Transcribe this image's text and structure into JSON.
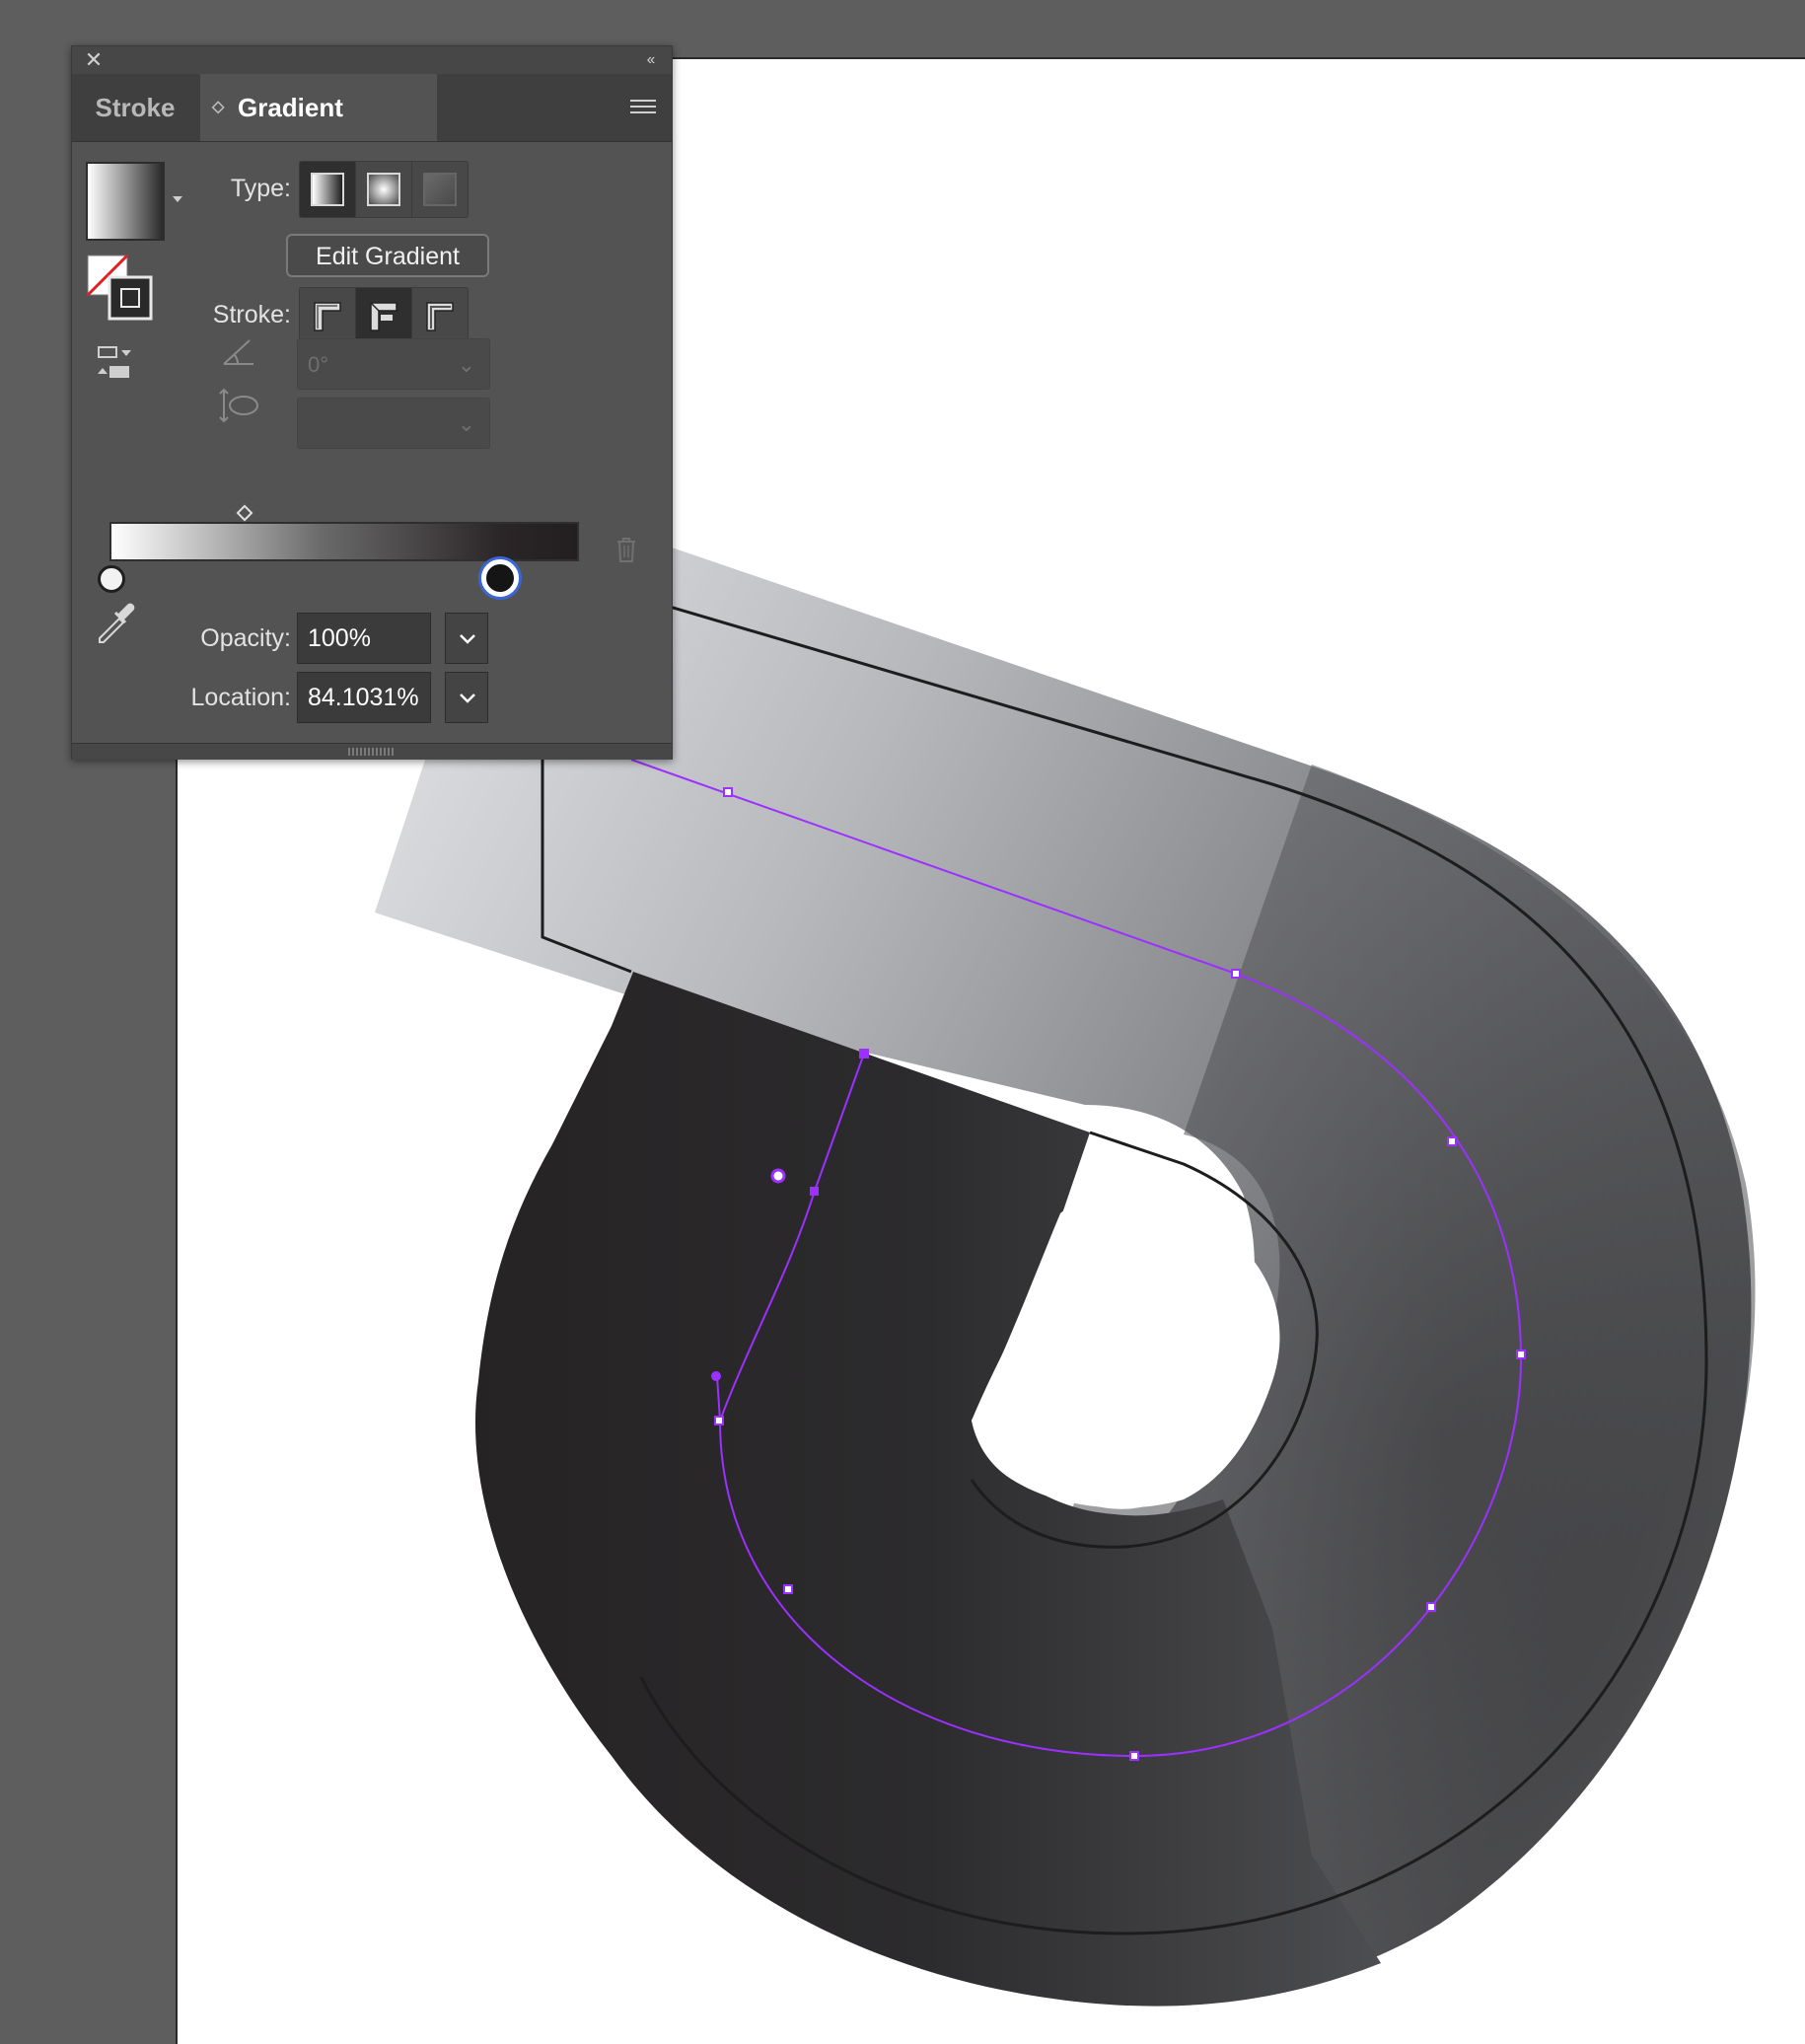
{
  "panel": {
    "tabs": [
      {
        "label": "Stroke",
        "active": false
      },
      {
        "label": "Gradient",
        "active": true
      }
    ],
    "type_label": "Type:",
    "type_options": [
      "linear-gradient-icon",
      "radial-gradient-icon",
      "freeform-gradient-icon"
    ],
    "type_selected": "linear",
    "edit_gradient_label": "Edit Gradient",
    "stroke_label": "Stroke:",
    "stroke_options": [
      "apply-within-stroke-icon",
      "apply-along-stroke-icon",
      "apply-across-stroke-icon"
    ],
    "stroke_selected": "along",
    "angle_value": "0°",
    "aspect_value": "",
    "opacity_label": "Opacity:",
    "opacity_value": "100%",
    "location_label": "Location:",
    "location_value": "84.1031%"
  },
  "gradient": {
    "stops": [
      {
        "color": "#ffffff",
        "location_pct": 0,
        "selected": false
      },
      {
        "color": "#231f20",
        "location_pct": 84.1031,
        "selected": true
      }
    ],
    "midpoint_pct": 30
  },
  "colors": {
    "panel_bg": "#535353",
    "app_bg": "#5e5e5e",
    "path_selection": "#9b30ff"
  }
}
